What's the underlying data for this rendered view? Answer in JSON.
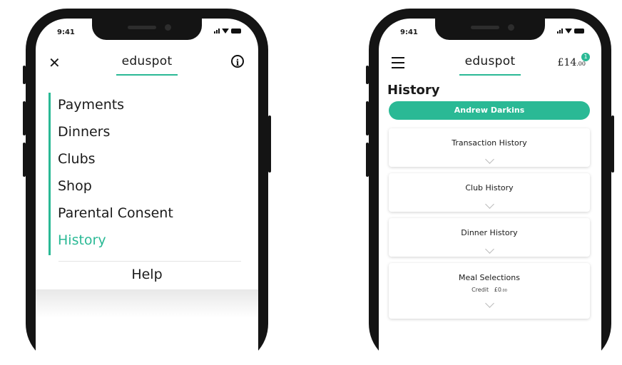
{
  "status_time": "9:41",
  "brand": {
    "logo": "eduspot",
    "accent": "#2ab995"
  },
  "left_phone": {
    "menu_items": [
      "Payments",
      "Dinners",
      "Clubs",
      "Shop",
      "Parental Consent",
      "History"
    ],
    "active_item": "History",
    "help": "Help",
    "close_icon": "close-icon",
    "info_icon": "info-icon"
  },
  "right_phone": {
    "balance": "£14",
    "balance_pence": ".00",
    "badge_count": "1",
    "page_title": "History",
    "student": "Andrew Darkins",
    "sections": [
      "Transaction History",
      "Club History",
      "Dinner History",
      "Meal Selections"
    ],
    "meal_credit_label": "Credit",
    "meal_credit_value": "£0",
    "meal_credit_pence": ".00"
  }
}
